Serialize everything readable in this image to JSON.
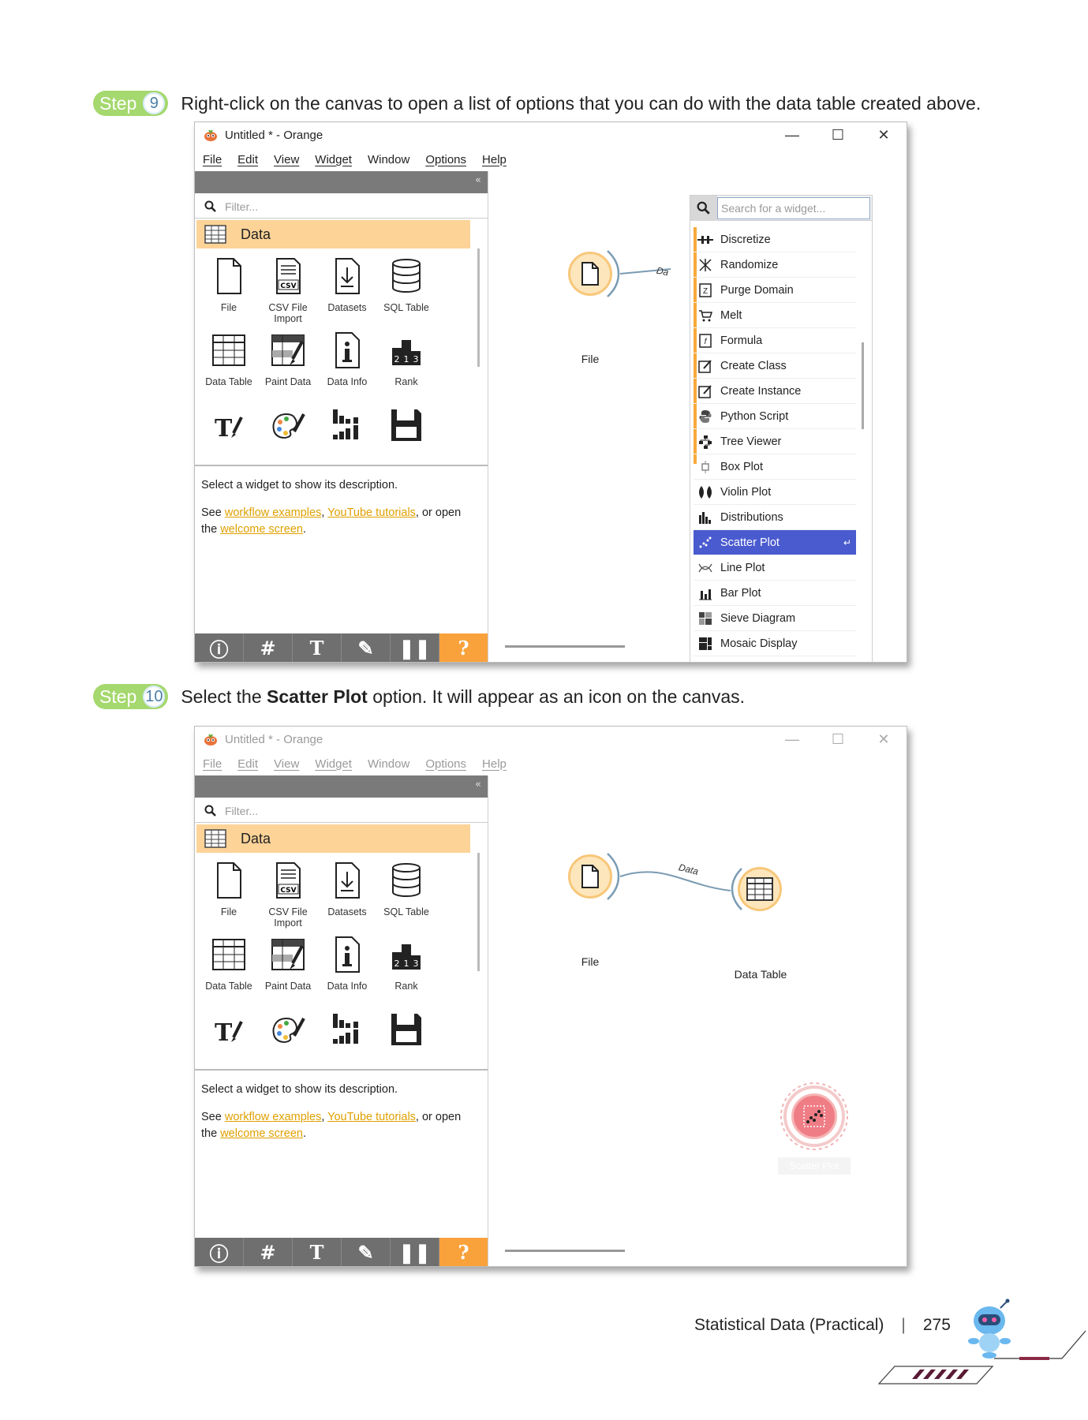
{
  "step9": {
    "word": "Step",
    "num": "9",
    "text": "Right-click on the canvas to open a list of options that you can do with the data table created above."
  },
  "step10": {
    "word": "Step",
    "num": "10",
    "text_before": "Select the ",
    "text_bold": "Scatter Plot",
    "text_after": " option. It will appear as an icon on the canvas."
  },
  "window": {
    "title": "Untitled * - Orange",
    "minimize": "—",
    "maximize": "☐",
    "close": "✕",
    "menu": [
      "File",
      "Edit",
      "View",
      "Widget",
      "Window",
      "Options",
      "Help"
    ],
    "collapse": "«",
    "filter_placeholder": "Filter...",
    "category": "Data",
    "tiles": [
      {
        "label": "File"
      },
      {
        "label": "CSV File Import"
      },
      {
        "label": "Datasets"
      },
      {
        "label": "SQL Table"
      },
      {
        "label": "Data Table"
      },
      {
        "label": "Paint Data"
      },
      {
        "label": "Data Info"
      },
      {
        "label": "Rank"
      }
    ],
    "desc_line": "Select a widget to show its description.",
    "desc_see": "See ",
    "desc_link1": "workflow examples",
    "desc_comma": ", ",
    "desc_link2": "YouTube tutorials",
    "desc_or": ", or open",
    "desc_the": "the ",
    "desc_link3": "welcome screen",
    "desc_dot": ".",
    "toolbar": [
      "ⓘ",
      "#",
      "T",
      "✎",
      "❚❚",
      "?"
    ]
  },
  "canvas1": {
    "file_label": "File",
    "link_label": "Da"
  },
  "canvas2": {
    "file_label": "File",
    "link_label": "Data",
    "table_label": "Data Table",
    "scatter_label": "Scatter Plot"
  },
  "popup": {
    "search_placeholder": "Search for a widget...",
    "items": [
      {
        "label": "Discretize"
      },
      {
        "label": "Randomize"
      },
      {
        "label": "Purge Domain"
      },
      {
        "label": "Melt"
      },
      {
        "label": "Formula"
      },
      {
        "label": "Create Class"
      },
      {
        "label": "Create Instance"
      },
      {
        "label": "Python Script"
      },
      {
        "label": "Tree Viewer"
      },
      {
        "label": "Box Plot"
      },
      {
        "label": "Violin Plot"
      },
      {
        "label": "Distributions"
      },
      {
        "label": "Scatter Plot",
        "selected": true
      },
      {
        "label": "Line Plot"
      },
      {
        "label": "Bar Plot"
      },
      {
        "label": "Sieve Diagram"
      },
      {
        "label": "Mosaic Display"
      }
    ],
    "enter_glyph": "↵"
  },
  "footer": {
    "chapter": "Statistical Data (Practical)",
    "separator": "|",
    "page": "275"
  },
  "colors": {
    "step_badge": "#a5d86e",
    "category": "#fdd398",
    "node_fill": "#fde6bb",
    "selection": "#4a5bd0",
    "help_button": "#f9a23b",
    "link": "#e0a000"
  }
}
